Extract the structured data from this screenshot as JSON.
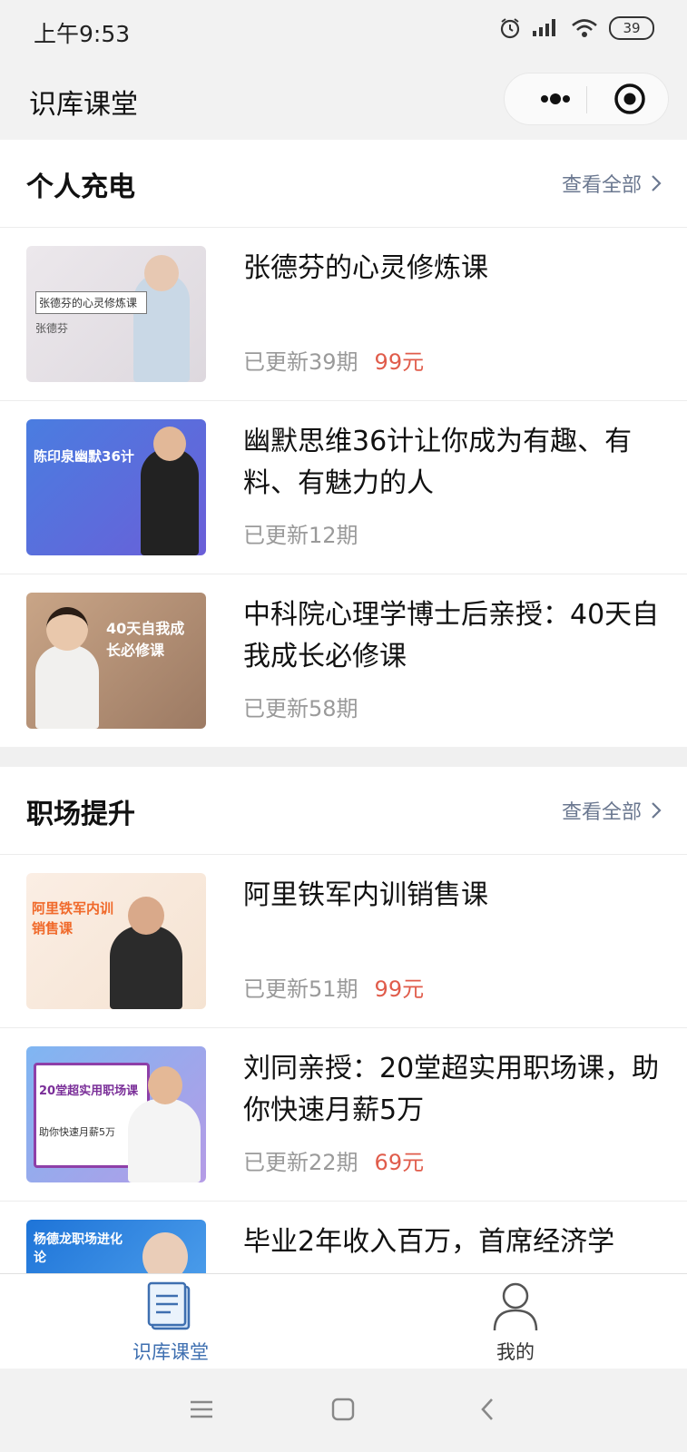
{
  "status_bar": {
    "time": "上午9:53",
    "battery": "39"
  },
  "app": {
    "title": "识库课堂"
  },
  "sections": [
    {
      "title": "个人充电",
      "view_all": "查看全部",
      "items": [
        {
          "title": "张德芬的心灵修炼课",
          "updated": "已更新39期",
          "price": "99元",
          "thumb_text": "张德芬的心灵修炼课",
          "thumb_sub": "张德芬"
        },
        {
          "title": "幽默思维36计让你成为有趣、有料、有魅力的人",
          "updated": "已更新12期",
          "price": "",
          "thumb_text": "陈印泉幽默36计"
        },
        {
          "title": "中科院心理学博士后亲授：40天自我成长必修课",
          "updated": "已更新58期",
          "price": "",
          "thumb_text": "40天自我成长必修课"
        }
      ]
    },
    {
      "title": "职场提升",
      "view_all": "查看全部",
      "items": [
        {
          "title": "阿里铁军内训销售课",
          "updated": "已更新51期",
          "price": "99元",
          "thumb_text": "阿里铁军内训销售课"
        },
        {
          "title": "刘同亲授：20堂超实用职场课，助你快速月薪5万",
          "updated": "已更新22期",
          "price": "69元",
          "thumb_text": "20堂超实用职场课",
          "thumb_sub": "助你快速月薪5万"
        },
        {
          "title": "毕业2年收入百万，首席经济学",
          "updated": "",
          "price": "",
          "thumb_text": "杨德龙职场进化论"
        }
      ]
    }
  ],
  "tabbar": {
    "tabs": [
      {
        "label": "识库课堂",
        "active": true
      },
      {
        "label": "我的",
        "active": false
      }
    ]
  },
  "colors": {
    "accent": "#4a6fa5",
    "price": "#e05c4b",
    "link": "#6b7890"
  }
}
